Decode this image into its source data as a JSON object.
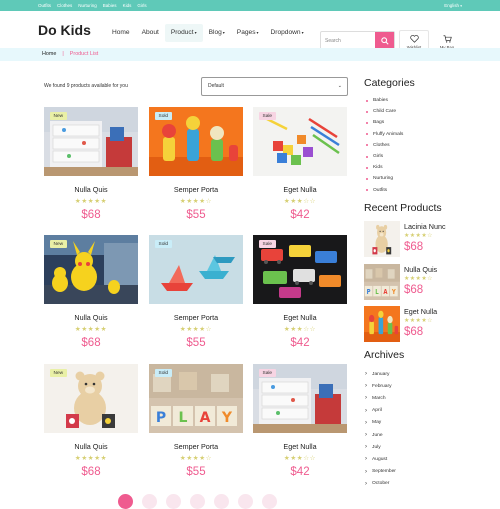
{
  "topbar": {
    "links": [
      "Outfits",
      "Clothes",
      "Nurturing",
      "Babies",
      "Kids",
      "Girls"
    ],
    "language": "English"
  },
  "header": {
    "logo": "Do Kids",
    "nav": [
      {
        "label": "Home",
        "dropdown": false
      },
      {
        "label": "About",
        "dropdown": false
      },
      {
        "label": "Product",
        "dropdown": true,
        "active": true
      },
      {
        "label": "Blog",
        "dropdown": true
      },
      {
        "label": "Pages",
        "dropdown": true
      },
      {
        "label": "Dropdown",
        "dropdown": true
      }
    ],
    "search_placeholder": "Search",
    "wishlist_label": "Wishlist",
    "bag_label": "My Bag",
    "accent_color": "#ef5b8f"
  },
  "breadcrumb": {
    "home": "Home",
    "separator": "|",
    "current": "Product List"
  },
  "toolbar": {
    "found_text": "We found 9 products available for you",
    "sort_value": "Default"
  },
  "products": [
    {
      "name": "Nulla Quis",
      "badge": "New",
      "rating": 5,
      "price": "$68",
      "image": "toy-dresser"
    },
    {
      "name": "Semper Porta",
      "badge": "Sold",
      "rating": 4,
      "price": "$55",
      "image": "wooden-figures"
    },
    {
      "name": "Eget Nulla",
      "badge": "Sale",
      "rating": 3,
      "price": "$42",
      "image": "crayons-blocks"
    },
    {
      "name": "Nulla Quis",
      "badge": "New",
      "rating": 5,
      "price": "$68",
      "image": "pikachu-toys"
    },
    {
      "name": "Semper Porta",
      "badge": "Sold",
      "rating": 4,
      "price": "$55",
      "image": "paper-boats"
    },
    {
      "name": "Eget Nulla",
      "badge": "Sale",
      "rating": 3,
      "price": "$42",
      "image": "toy-cars"
    },
    {
      "name": "Nulla Quis",
      "badge": "New",
      "rating": 5,
      "price": "$68",
      "image": "teddy-bear"
    },
    {
      "name": "Semper Porta",
      "badge": "Sold",
      "rating": 4,
      "price": "$55",
      "image": "play-blocks"
    },
    {
      "name": "Eget Nulla",
      "badge": "Sale",
      "rating": 3,
      "price": "$42",
      "image": "toy-dresser"
    }
  ],
  "sidebar": {
    "categories_title": "Categories",
    "categories": [
      "Babies",
      "Child Care",
      "Bags",
      "Fluffy Animals",
      "Clothes",
      "Girls",
      "Kids",
      "Nurturing",
      "Outfits"
    ],
    "recent_title": "Recent Products",
    "recent": [
      {
        "name": "Lacinia Nunc",
        "rating": 4,
        "price": "$68",
        "image": "teddy-bear"
      },
      {
        "name": "Nulla Quis",
        "rating": 4,
        "price": "$68",
        "image": "play-blocks"
      },
      {
        "name": "Eget Nulla",
        "rating": 4,
        "price": "$68",
        "image": "wooden-figures"
      }
    ],
    "archives_title": "Archives",
    "archives": [
      "January",
      "February",
      "March",
      "April",
      "May",
      "June",
      "July",
      "August",
      "September",
      "October"
    ]
  },
  "pagination": {
    "pages": 7,
    "current": 1
  }
}
